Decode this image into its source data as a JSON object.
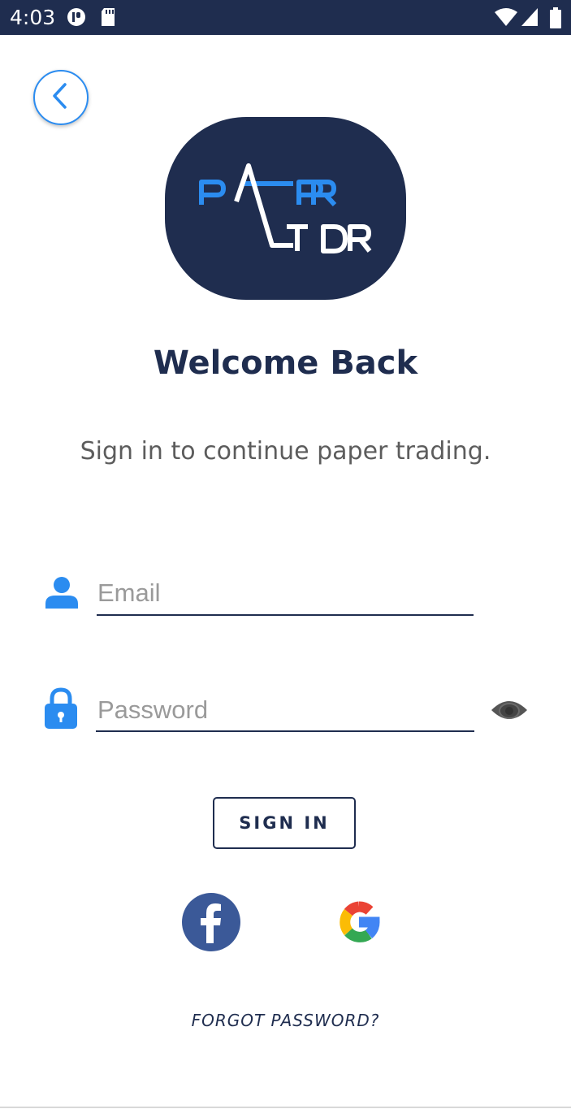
{
  "status_bar": {
    "time": "4:03",
    "icons": [
      "media-icon",
      "sd-card-icon",
      "wifi-icon",
      "signal-icon",
      "battery-icon"
    ]
  },
  "header": {
    "back_icon": "chevron-left-icon"
  },
  "logo": {
    "line1": "PAPR",
    "line2": "TDR",
    "bg_color": "#1f2d4f",
    "accent_color": "#2b8cf0"
  },
  "welcome": {
    "title": "Welcome Back",
    "subtitle": "Sign in to continue paper trading."
  },
  "form": {
    "email": {
      "placeholder": "Email",
      "value": "",
      "icon": "user-icon"
    },
    "password": {
      "placeholder": "Password",
      "value": "",
      "icon": "lock-icon",
      "toggle_icon": "eye-icon"
    },
    "sign_in_label": "SIGN IN"
  },
  "social": {
    "facebook_icon": "facebook-icon",
    "google_icon": "google-icon"
  },
  "forgot_password": "FORGOT PASSWORD?",
  "colors": {
    "primary": "#1f2d4f",
    "accent": "#2b8cf0"
  }
}
